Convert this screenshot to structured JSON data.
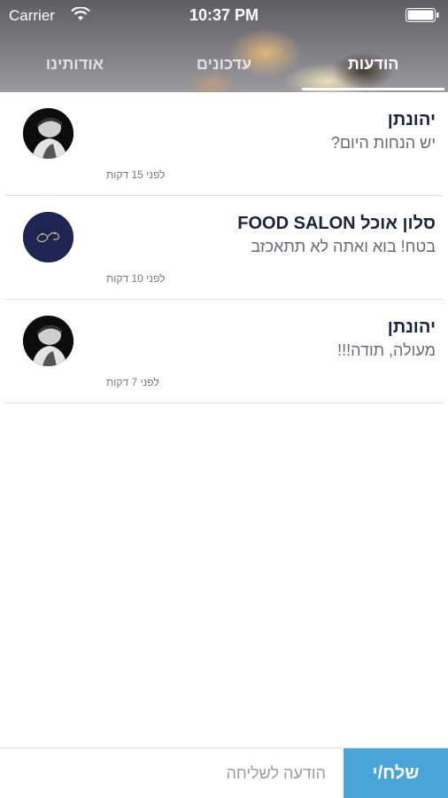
{
  "status_bar": {
    "carrier": "Carrier",
    "time": "10:37 PM",
    "icons": [
      "wifi-icon",
      "battery-icon"
    ]
  },
  "tabs": [
    {
      "label": "הודעות",
      "active": true
    },
    {
      "label": "עדכונים",
      "active": false
    },
    {
      "label": "אודותינו",
      "active": false
    }
  ],
  "messages": [
    {
      "sender": "יהונתן",
      "text": "יש הנחות היום?",
      "time": "לפני 15 דקות",
      "avatar": "person-avatar"
    },
    {
      "sender": "סלון אוכל FOOD SALON",
      "text": "בטח! בוא ואתה לא תתאכזב",
      "time": "לפני 10 דקות",
      "avatar": "logo-avatar"
    },
    {
      "sender": "יהונתן",
      "text": "מעולה, תודה!!!",
      "time": "לפני 7 דקות",
      "avatar": "person-avatar"
    }
  ],
  "composer": {
    "placeholder": "הודעה לשליחה",
    "value": "",
    "send_label": "שלח/י"
  },
  "colors": {
    "accent": "#49a4d8",
    "sender_text": "#1a2340",
    "logo_bg": "#1f2552"
  }
}
